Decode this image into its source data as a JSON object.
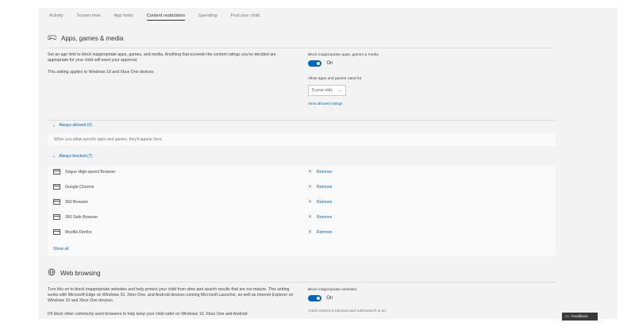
{
  "tabs": [
    "Activity",
    "Screen time",
    "App limits",
    "Content restrictions",
    "Spending",
    "Find your child"
  ],
  "apps_section": {
    "title": "Apps, games & media",
    "description": "Set an age limit to block inappropriate apps, games, and media. Anything that exceeds the content ratings you've decided are appropriate for your child will need your approval.",
    "applies_to": "This setting applies to Windows 10 and Xbox One devices",
    "toggle_label": "Block inappropriate apps, games & media",
    "toggle_state": "On",
    "allow_label": "Allow apps and games rated for",
    "age_value": "8-year-olds",
    "view_allowed": "View allowed ratings"
  },
  "always_allowed": {
    "header": "Always allowed (0)",
    "empty_text": "When you allow specific apps and games, they'll appear here."
  },
  "always_blocked": {
    "header": "Always blocked (7)",
    "remove_label": "Remove",
    "items": [
      "Sogue High-speed Browser",
      "Google Chrome",
      "360 Browser",
      "360 Safe Browser",
      "Mozilla Firefox"
    ],
    "show_all": "Show all"
  },
  "web_section": {
    "title": "Web browsing",
    "description": "Turn this on to block inappropriate websites and help protect your child from sites and search results that are too mature. This setting works with Microsoft Edge on Windows 10, Xbox One, and Android devices running Microsoft Launcher, as well as Internet Explorer on Windows 10 and Xbox One devices.",
    "description2": "It'll block other commonly used browsers to help keep your child safer on Windows 10, Xbox One and Android",
    "toggle_label": "Block inappropriate websites",
    "toggle_state": "On",
    "note": "Adult content is blocked and SafeSearch is on."
  },
  "feedback_label": "Feedback"
}
